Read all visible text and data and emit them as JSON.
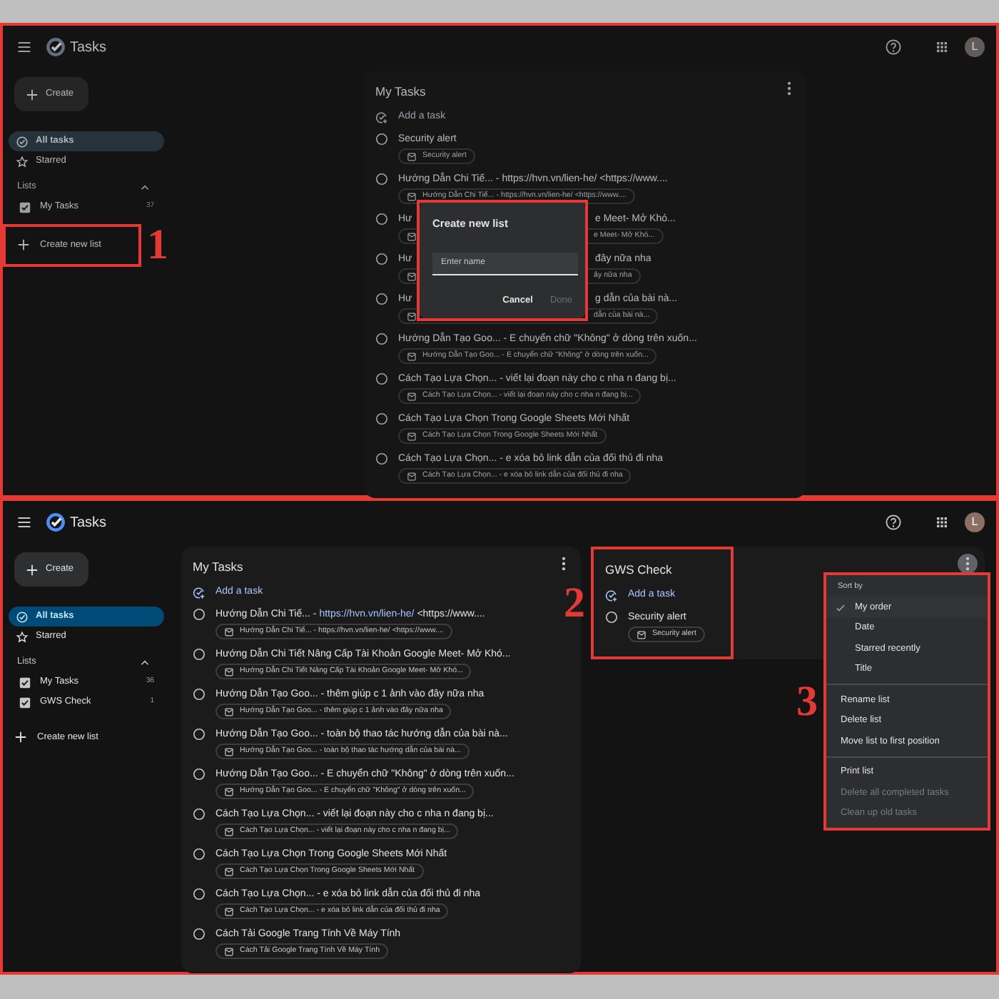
{
  "screens": [
    {
      "header": {
        "title": "Tasks",
        "avatar": "L"
      },
      "sidebar": {
        "create": "Create",
        "nav": [
          {
            "kind": "all",
            "label": "All tasks",
            "selected": true
          },
          {
            "kind": "starred",
            "label": "Starred",
            "selected": false
          }
        ],
        "lists_heading": "Lists",
        "lists": [
          {
            "name": "My Tasks",
            "checked": true,
            "count": "37"
          }
        ],
        "new_list": "Create new list",
        "new_list_highlight": {
          "callout": "1"
        }
      },
      "task_lists": [
        {
          "title": "My Tasks",
          "add": "Add a task",
          "menu_open": false,
          "tasks": [
            {
              "kind": "task",
              "checked": false,
              "title": "Security alert",
              "chip": "Security alert"
            },
            {
              "kind": "task",
              "checked": false,
              "title": "Hướng Dẫn Chi Tiế... - https://hvn.vn/lien-he/ <https://www....",
              "chip": "Hướng Dẫn Chi Tiế... - https://hvn.vn/lien-he/ <https://www...."
            },
            {
              "kind": "covered",
              "checked": false,
              "title_left": "Hư",
              "title_right": "e Meet- Mở Khó...",
              "chip_right": "e Meet- Mở Khó..."
            },
            {
              "kind": "covered",
              "checked": false,
              "title_left": "Hư",
              "title_right": "đây nữa nha",
              "chip_right": "ây nữa nha"
            },
            {
              "kind": "covered",
              "checked": false,
              "title_left": "Hư",
              "title_right": "g dẫn của bài nà...",
              "chip_right": "dẫn của bài nà..."
            },
            {
              "kind": "task",
              "checked": false,
              "title": "Hướng Dẫn Tạo Goo... - E chuyển chữ \"Không\" ở dòng trên xuốn...",
              "chip": "Hướng Dẫn Tạo Goo... - E chuyển chữ \"Không\" ở dòng trên xuốn..."
            },
            {
              "kind": "task",
              "checked": false,
              "title": "Cách Tạo Lựa Chọn... - viết lại đoạn này cho c nha n đang bị...",
              "chip": "Cách Tạo Lựa Chọn... - viết lại đoạn này cho c nha n đang bị..."
            },
            {
              "kind": "task",
              "checked": false,
              "title": "Cách Tạo Lựa Chọn Trong Google Sheets Mới Nhất",
              "chip": "Cách Tạo Lựa Chọn Trong Google Sheets Mới Nhất"
            },
            {
              "kind": "task",
              "checked": false,
              "title": "Cách Tạo Lựa Chọn... - e xóa bỏ link dẫn của đối thủ đi nha",
              "chip": "Cách Tạo Lựa Chọn... - e xóa bỏ link dẫn của đối thủ đi nha"
            }
          ]
        }
      ],
      "dialog": {
        "title": "Create new list",
        "placeholder": "Enter name",
        "buttons": [
          {
            "label": "Cancel",
            "disabled": false
          },
          {
            "label": "Done",
            "disabled": true
          }
        ],
        "highlighted": true
      }
    },
    {
      "header": {
        "title": "Tasks",
        "avatar": "L"
      },
      "sidebar": {
        "create": "Create",
        "nav": [
          {
            "kind": "all",
            "label": "All tasks",
            "selected": true
          },
          {
            "kind": "starred",
            "label": "Starred",
            "selected": false
          }
        ],
        "lists_heading": "Lists",
        "lists": [
          {
            "name": "My Tasks",
            "checked": true,
            "count": "36"
          },
          {
            "name": "GWS Check",
            "checked": true,
            "count": "1"
          }
        ],
        "new_list": "Create new list"
      },
      "task_lists": [
        {
          "title": "My Tasks",
          "add": "Add a task",
          "menu_open": false,
          "tasks": [
            {
              "kind": "task",
              "checked": false,
              "title": "Hướng Dẫn Chi Tiế... - ",
              "link": "https://hvn.vn/lien-he/",
              "title_after": " <https://www....",
              "chip": "Hướng Dẫn Chi Tiế... - https://hvn.vn/lien-he/ <https://www...."
            },
            {
              "kind": "task",
              "checked": false,
              "title": "Hướng Dẫn Chi Tiết Nâng Cấp Tài Khoản Google Meet- Mở Khó...",
              "chip": "Hướng Dẫn Chi Tiết Nâng Cấp Tài Khoản Google Meet- Mở Khó..."
            },
            {
              "kind": "task",
              "checked": false,
              "title": "Hướng Dẫn Tạo Goo... - thêm giúp c 1 ảnh vào đây nữa nha",
              "chip": "Hướng Dẫn Tạo Goo... - thêm giúp c 1 ảnh vào đây nữa nha"
            },
            {
              "kind": "task",
              "checked": false,
              "title": "Hướng Dẫn Tạo Goo... - toàn bộ thao tác hướng dẫn của bài nà...",
              "chip": "Hướng Dẫn Tạo Goo... - toàn bộ thao tác hướng dẫn của bài nà..."
            },
            {
              "kind": "task",
              "checked": false,
              "title": "Hướng Dẫn Tạo Goo... - E chuyển chữ \"Không\" ở dòng trên xuốn...",
              "chip": "Hướng Dẫn Tạo Goo... - E chuyển chữ \"Không\" ở dòng trên xuốn..."
            },
            {
              "kind": "task",
              "checked": false,
              "title": "Cách Tạo Lựa Chọn... - viết lại đoạn này cho c nha n đang bị...",
              "chip": "Cách Tạo Lựa Chọn... - viết lại đoạn này cho c nha n đang bị..."
            },
            {
              "kind": "task",
              "checked": false,
              "title": "Cách Tạo Lựa Chọn Trong Google Sheets Mới Nhất",
              "chip": "Cách Tạo Lựa Chọn Trong Google Sheets Mới Nhất"
            },
            {
              "kind": "task",
              "checked": false,
              "title": "Cách Tạo Lựa Chọn... - e xóa bỏ link dẫn của đối thủ đi nha",
              "chip": "Cách Tạo Lựa Chọn... - e xóa bỏ link dẫn của đối thủ đi nha"
            },
            {
              "kind": "task",
              "checked": false,
              "title": "Cách Tải Google Trang Tính Về Máy Tính",
              "chip": "Cách Tải Google Trang Tính Về Máy Tính"
            }
          ]
        },
        {
          "title": "GWS Check",
          "add": "Add a task",
          "menu_open": true,
          "highlight": {
            "callout": "2"
          },
          "tasks": [
            {
              "kind": "task",
              "checked": false,
              "title": "Security alert",
              "chip": "Security alert"
            }
          ]
        }
      ],
      "menu": {
        "heading": "Sort by",
        "sort_options": [
          {
            "label": "My order",
            "selected": true
          },
          {
            "label": "Date",
            "selected": false
          },
          {
            "label": "Starred recently",
            "selected": false
          },
          {
            "label": "Title",
            "selected": false
          }
        ],
        "action_groups": [
          [
            {
              "label": "Rename list",
              "disabled": false
            },
            {
              "label": "Delete list",
              "disabled": false
            },
            {
              "label": "Move list to first position",
              "disabled": false
            }
          ],
          [
            {
              "label": "Print list",
              "disabled": false
            },
            {
              "label": "Delete all completed tasks",
              "disabled": true
            },
            {
              "label": "Clean up old tasks",
              "disabled": true
            }
          ]
        ],
        "highlight": {
          "callout": "3"
        }
      }
    }
  ]
}
